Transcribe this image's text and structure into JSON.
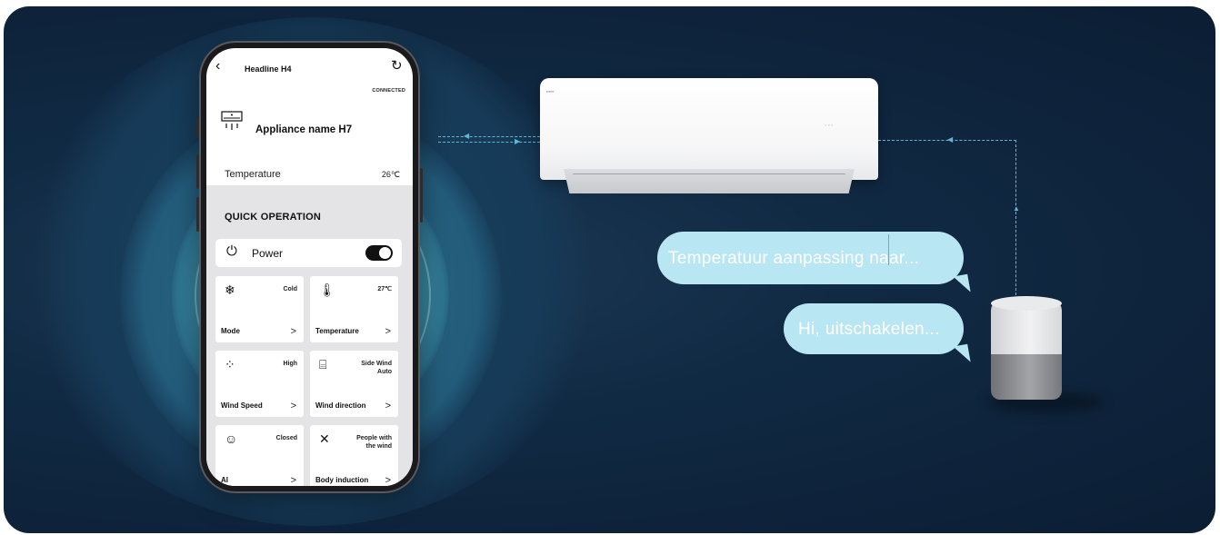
{
  "phone": {
    "header_title": "Headline H4",
    "back_icon": "chevron-left-icon",
    "refresh_icon": "refresh-icon",
    "status": "CONNECTED",
    "appliance_name": "Appliance name H7",
    "temperature_label": "Temperature",
    "temperature_value": "26℃",
    "section_title": "QUICK OPERATION",
    "power_label": "Power",
    "power_on": true,
    "cards": [
      {
        "icon": "snowflake-icon",
        "status": "Cold",
        "name": "Mode"
      },
      {
        "icon": "thermometer-icon",
        "status": "27℃",
        "name": "Temperature"
      },
      {
        "icon": "wind-speed-icon",
        "status": "High",
        "name": "Wind Speed"
      },
      {
        "icon": "wind-direction-icon",
        "status_line1": "Side Wind",
        "status_line2": "Auto",
        "name": "Wind direction"
      },
      {
        "icon": "ai-head-icon",
        "status": "Closed",
        "name": "AI"
      },
      {
        "icon": "person-wind-icon",
        "status_line1": "People with",
        "status_line2": "the wind",
        "name": "Body induction"
      }
    ],
    "arrow_glyph": ">"
  },
  "bubbles": {
    "first": "Temperatuur aanpassing naar...",
    "second": "Hi, uitschakelen..."
  },
  "colors": {
    "background": "#0f2640",
    "halo": "#3a869f",
    "bubble": "#b9e6f3",
    "connector": "#5fb7d6"
  }
}
